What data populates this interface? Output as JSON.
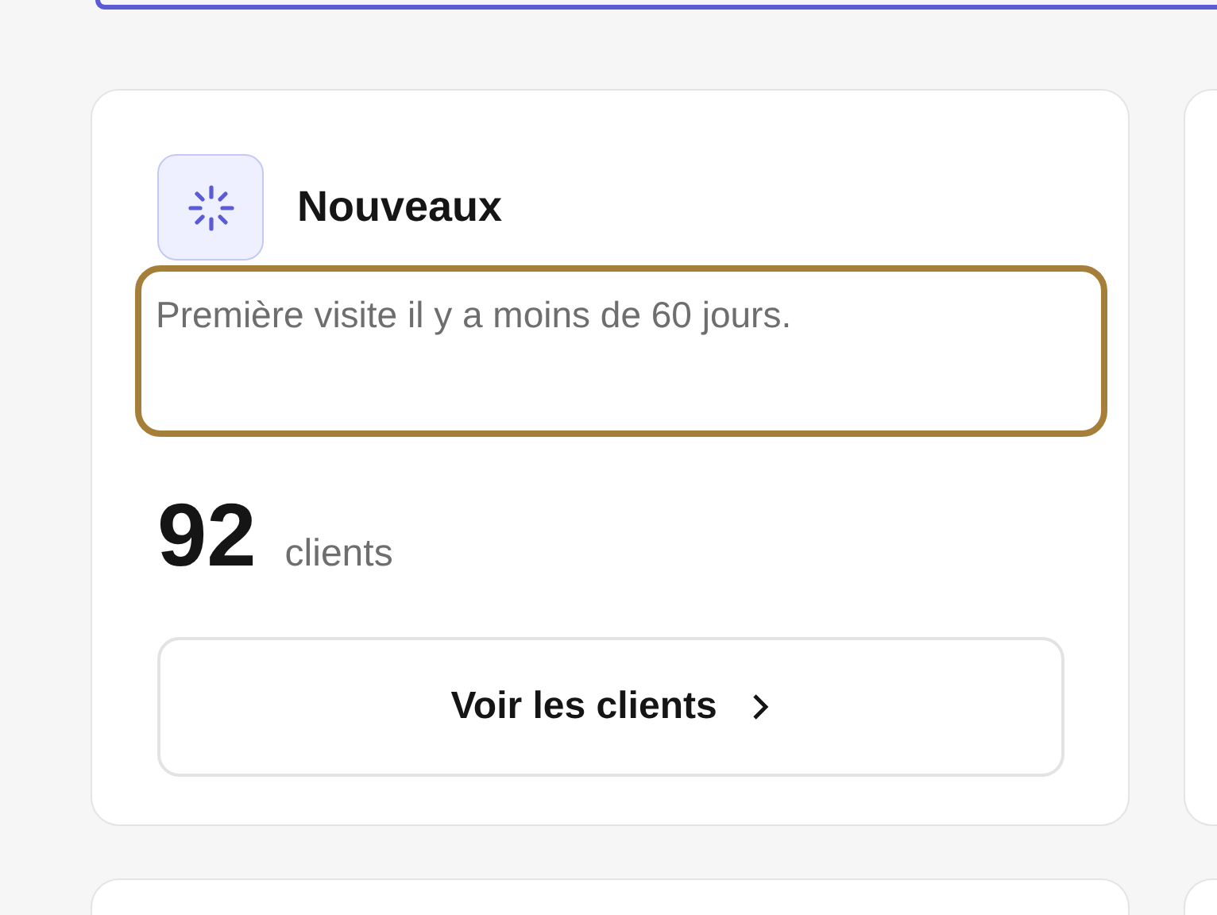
{
  "segment_card": {
    "title": "Nouveaux",
    "description": "Première visite il y a moins de 60 jours.",
    "count": "92",
    "unit": "clients",
    "button": "Voir les clients"
  }
}
